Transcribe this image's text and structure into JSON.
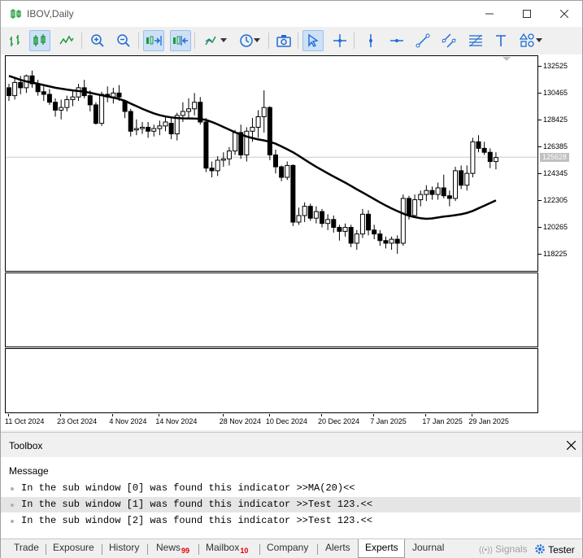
{
  "window": {
    "title": "IBOV,Daily"
  },
  "toolbar": {
    "buttons": [
      "bar-chart-icon",
      "candlestick-icon",
      "line-chart-icon",
      "zoom-in-icon",
      "zoom-out-icon",
      "auto-scroll-icon",
      "chart-shift-icon",
      "indicators-icon",
      "periods-icon",
      "screenshot-icon",
      "cursor-icon",
      "crosshair-icon",
      "vertical-line-icon",
      "horizontal-line-icon",
      "trendline-icon",
      "channel-icon",
      "fibonacci-icon",
      "text-icon",
      "shapes-icon"
    ]
  },
  "chart_data": {
    "type": "candlestick",
    "symbol": "IBOV",
    "timeframe": "Daily",
    "ylim": [
      117000,
      133300
    ],
    "price_ticks": [
      "132525",
      "130465",
      "128425",
      "126385",
      "124345",
      "122305",
      "120265",
      "118225"
    ],
    "current_price": "125628",
    "date_ticks": [
      "11 Oct 2024",
      "23 Oct 2024",
      "4 Nov 2024",
      "14 Nov 2024",
      "28 Nov 2024",
      "10 Dec 2024",
      "20 Dec 2024",
      "7 Jan 2025",
      "17 Jan 2025",
      "29 Jan 2025"
    ],
    "candles": [
      [
        130900,
        131200,
        129900,
        130300
      ],
      [
        130300,
        131700,
        130000,
        131300
      ],
      [
        131300,
        131800,
        130400,
        130900
      ],
      [
        130900,
        131900,
        130500,
        131800
      ],
      [
        131800,
        132200,
        130900,
        131200
      ],
      [
        131200,
        131500,
        130300,
        130600
      ],
      [
        130600,
        131000,
        129900,
        130400
      ],
      [
        130400,
        130800,
        129600,
        129800
      ],
      [
        129800,
        130100,
        128700,
        129200
      ],
      [
        129200,
        130000,
        128500,
        129400
      ],
      [
        129400,
        130300,
        129100,
        130000
      ],
      [
        130000,
        130700,
        129500,
        130200
      ],
      [
        130200,
        131200,
        129900,
        130900
      ],
      [
        130900,
        131500,
        130100,
        130300
      ],
      [
        130300,
        130700,
        129100,
        129600
      ],
      [
        129600,
        129800,
        128100,
        128200
      ],
      [
        128200,
        130600,
        128000,
        130400
      ],
      [
        130400,
        131000,
        129800,
        130200
      ],
      [
        130200,
        130900,
        129700,
        130500
      ],
      [
        130500,
        131100,
        129900,
        130200
      ],
      [
        129900,
        130000,
        128600,
        129100
      ],
      [
        129100,
        129300,
        127200,
        127600
      ],
      [
        127700,
        128500,
        127300,
        127800
      ],
      [
        127800,
        128300,
        127400,
        127900
      ],
      [
        127900,
        128300,
        127100,
        127600
      ],
      [
        127600,
        128100,
        127200,
        127800
      ],
      [
        127800,
        128400,
        127300,
        128000
      ],
      [
        128000,
        128800,
        127600,
        128300
      ],
      [
        128200,
        128600,
        127000,
        127400
      ],
      [
        127400,
        129000,
        126900,
        128800
      ],
      [
        128800,
        129800,
        128300,
        129100
      ],
      [
        129100,
        130100,
        128600,
        129300
      ],
      [
        129300,
        130500,
        128800,
        129800
      ],
      [
        129800,
        130200,
        128100,
        128300
      ],
      [
        128300,
        128600,
        124500,
        124800
      ],
      [
        124800,
        125300,
        124100,
        124600
      ],
      [
        124600,
        125700,
        124200,
        125400
      ],
      [
        125400,
        126000,
        124900,
        125500
      ],
      [
        125500,
        126400,
        125000,
        126100
      ],
      [
        126100,
        127700,
        125800,
        127500
      ],
      [
        127500,
        128100,
        125500,
        125800
      ],
      [
        125800,
        127900,
        125300,
        127600
      ],
      [
        127600,
        128600,
        126800,
        127900
      ],
      [
        127900,
        129200,
        127100,
        128700
      ],
      [
        128700,
        130700,
        127500,
        129400
      ],
      [
        129400,
        129500,
        125400,
        125800
      ],
      [
        125800,
        126200,
        124400,
        124900
      ],
      [
        124900,
        125000,
        123800,
        124100
      ],
      [
        124100,
        125300,
        123900,
        125000
      ],
      [
        125000,
        125100,
        120400,
        120700
      ],
      [
        120700,
        121800,
        120500,
        121200
      ],
      [
        121200,
        122200,
        120700,
        121900
      ],
      [
        121900,
        122100,
        120800,
        121000
      ],
      [
        121000,
        121900,
        120600,
        121500
      ],
      [
        121500,
        121700,
        120300,
        120600
      ],
      [
        120600,
        121300,
        120100,
        120900
      ],
      [
        120900,
        121200,
        119900,
        120300
      ],
      [
        120300,
        120500,
        119300,
        120000
      ],
      [
        120000,
        120600,
        119600,
        120300
      ],
      [
        120300,
        120500,
        118800,
        119100
      ],
      [
        119100,
        120100,
        118600,
        119800
      ],
      [
        119800,
        121700,
        119500,
        121300
      ],
      [
        121300,
        121600,
        119700,
        120100
      ],
      [
        120100,
        120500,
        119400,
        119800
      ],
      [
        119800,
        120100,
        118900,
        119300
      ],
      [
        119300,
        119600,
        118700,
        119100
      ],
      [
        119100,
        119600,
        118600,
        119400
      ],
      [
        119400,
        119700,
        118300,
        119100
      ],
      [
        119100,
        122800,
        118900,
        122500
      ],
      [
        122500,
        122700,
        120900,
        121200
      ],
      [
        121200,
        122800,
        121000,
        122400
      ],
      [
        122400,
        123100,
        121900,
        122800
      ],
      [
        122800,
        123500,
        122300,
        123100
      ],
      [
        123100,
        123400,
        122400,
        122800
      ],
      [
        122800,
        123700,
        122400,
        123300
      ],
      [
        123300,
        124300,
        122500,
        122700
      ],
      [
        122700,
        123100,
        121900,
        122500
      ],
      [
        122500,
        124900,
        122300,
        124600
      ],
      [
        124600,
        125000,
        123200,
        123500
      ],
      [
        123500,
        125000,
        123100,
        124400
      ],
      [
        124400,
        127100,
        124100,
        126800
      ],
      [
        126800,
        127300,
        126000,
        126300
      ],
      [
        126300,
        126800,
        125800,
        126000
      ],
      [
        126000,
        126300,
        124800,
        125300
      ],
      [
        125300,
        126000,
        124700,
        125600
      ]
    ],
    "ma": {
      "name": "MA(20)",
      "color": "#000000",
      "values": [
        131800,
        131650,
        131500,
        131380,
        131300,
        131200,
        131100,
        131000,
        130900,
        130830,
        130760,
        130700,
        130650,
        130600,
        130520,
        130420,
        130330,
        130240,
        130150,
        130050,
        129900,
        129700,
        129500,
        129300,
        129120,
        128950,
        128820,
        128720,
        128650,
        128600,
        128580,
        128570,
        128560,
        128540,
        128450,
        128300,
        128120,
        127920,
        127720,
        127520,
        127350,
        127200,
        127080,
        126980,
        126900,
        126800,
        126650,
        126450,
        126230,
        126000,
        125730,
        125450,
        125170,
        124900,
        124650,
        124400,
        124160,
        123930,
        123700,
        123450,
        123190,
        122950,
        122700,
        122450,
        122200,
        121960,
        121740,
        121540,
        121350,
        121180,
        121080,
        121000,
        120950,
        120980,
        121050,
        121120,
        121170,
        121230,
        121300,
        121400,
        121550,
        121750,
        121950,
        122150,
        122350
      ]
    }
  },
  "toolbox": {
    "title": "Toolbox",
    "column": "Message",
    "rows": [
      "In the sub window [0] was found this indicator >>MA(20)<<",
      "In the sub window [1] was found this indicator >>Test 123.<<",
      "In the sub window [2] was found this indicator >>Test 123.<<"
    ],
    "tabs": [
      {
        "label": "Trade",
        "badge": ""
      },
      {
        "label": "Exposure",
        "badge": ""
      },
      {
        "label": "History",
        "badge": ""
      },
      {
        "label": "News",
        "badge": "99"
      },
      {
        "label": "Mailbox",
        "badge": "10"
      },
      {
        "label": "Company",
        "badge": ""
      },
      {
        "label": "Alerts",
        "badge": ""
      },
      {
        "label": "Experts",
        "badge": ""
      },
      {
        "label": "Journal",
        "badge": ""
      }
    ],
    "signals": "Signals",
    "tester": "Tester"
  },
  "colors": {
    "accent": "#1e6bd6",
    "green": "#1a9a3a",
    "selected": "#cde0f7"
  }
}
